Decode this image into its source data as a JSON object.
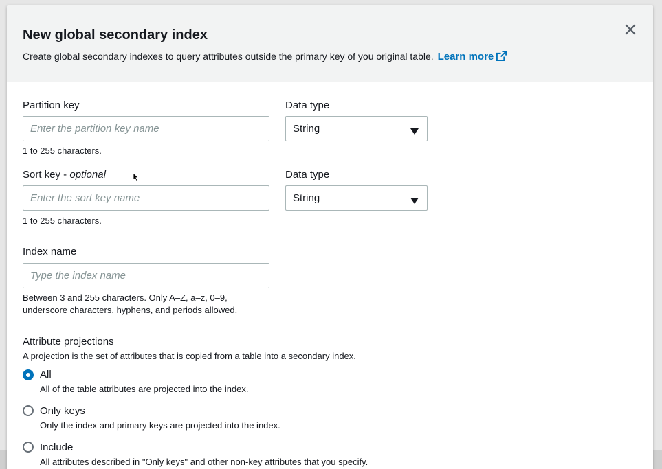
{
  "modal": {
    "title": "New global secondary index",
    "description": "Create global secondary indexes to query attributes outside the primary key of you original table.",
    "learn_more": "Learn more"
  },
  "partition_key": {
    "label": "Partition key",
    "placeholder": "Enter the partition key name",
    "hint": "1 to 255 characters.",
    "data_type_label": "Data type",
    "data_type_value": "String"
  },
  "sort_key": {
    "label_main": "Sort key - ",
    "label_optional": "optional",
    "placeholder": "Enter the sort key name",
    "hint": "1 to 255 characters.",
    "data_type_label": "Data type",
    "data_type_value": "String"
  },
  "index_name": {
    "label": "Index name",
    "placeholder": "Type the index name",
    "hint_line1": "Between 3 and 255 characters. Only A–Z, a–z, 0–9,",
    "hint_line2": "underscore characters, hyphens, and periods allowed."
  },
  "projections": {
    "label": "Attribute projections",
    "description": "A projection is the set of attributes that is copied from a table into a secondary index.",
    "options": [
      {
        "label": "All",
        "desc": "All of the table attributes are projected into the index.",
        "checked": true
      },
      {
        "label": "Only keys",
        "desc": "Only the index and primary keys are projected into the index.",
        "checked": false
      },
      {
        "label": "Include",
        "desc": "All attributes described in \"Only keys\" and other non-key attributes that you specify.",
        "checked": false
      }
    ]
  },
  "colors": {
    "link": "#0073bb",
    "radio_selected": "#0073bb",
    "header_bg": "#f2f3f3"
  }
}
